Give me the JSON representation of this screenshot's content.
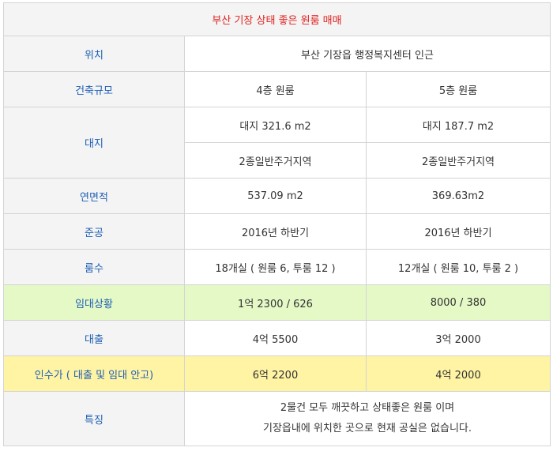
{
  "title": "부산 기장 상태 좋은 원룸 매매",
  "rows": {
    "location": {
      "label": "위치",
      "value": "부산 기장읍 행정복지센터 인근"
    },
    "scale": {
      "label": "건축규모",
      "a": "4층 원룸",
      "b": "5층 원룸"
    },
    "land": {
      "label": "대지",
      "a1": "대지 321.6 m2",
      "b1": "대지 187.7 m2",
      "a2": "2종일반주거지역",
      "b2": "2종일반주거지역"
    },
    "floor_area": {
      "label": "연면적",
      "a": "537.09 m2",
      "b": "369.63m2"
    },
    "completion": {
      "label": "준공",
      "a": "2016년 하반기",
      "b": "2016년 하반기"
    },
    "rooms": {
      "label": "룸수",
      "a": "18개실 ( 원룸 6, 투룸 12 )",
      "b": "12개실 ( 원룸 10, 투룸 2 )"
    },
    "lease": {
      "label": "임대상황",
      "a": "1억 2300 / 626",
      "b": "8000 / 380"
    },
    "loan": {
      "label": "대출",
      "a": "4억 5500",
      "b": "3억 2000"
    },
    "price": {
      "label": "인수가 ( 대출 및 임대 안고)",
      "a": "6억 2200",
      "b": "4억 2000"
    },
    "features": {
      "label": "특징",
      "line1": "2물건 모두 깨끗하고 상태좋은 원룸 이며",
      "line2": "기장읍내에 위치한 곳으로 현재 공실은 없습니다."
    }
  },
  "colors": {
    "label_text": "#1f5fb4",
    "title_text": "#e02020",
    "highlight_green": "#e4f9c6",
    "highlight_yellow": "#fff3a4"
  }
}
